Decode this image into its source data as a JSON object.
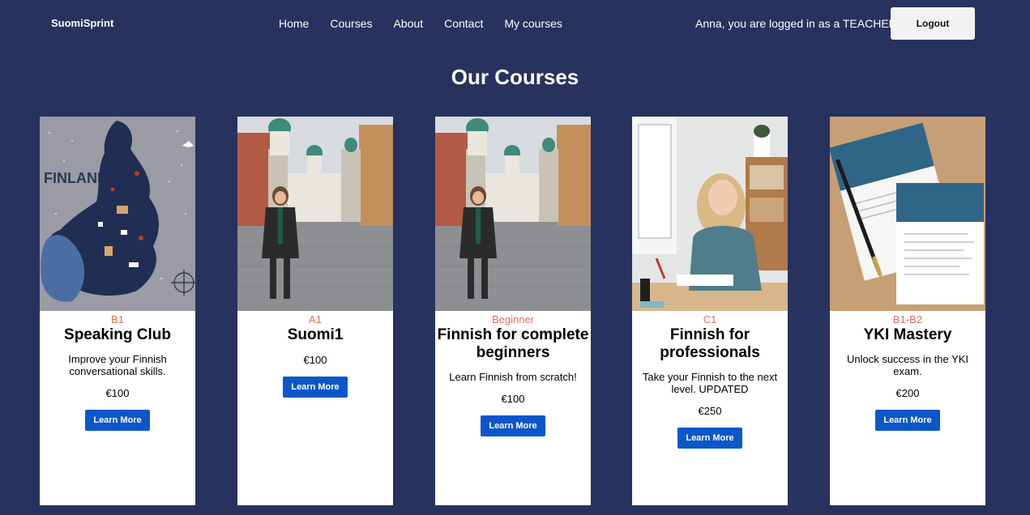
{
  "nav": {
    "brand": "SuomiSprint",
    "links": [
      "Home",
      "Courses",
      "About",
      "Contact",
      "My courses"
    ],
    "user_status": "Anna, you are logged in as a TEACHER",
    "logout_label": "Logout"
  },
  "page": {
    "title": "Our Courses"
  },
  "courses": [
    {
      "level": "B1",
      "title": "Speaking Club",
      "description": "Improve your Finnish conversational skills.",
      "price": "€100",
      "button": "Learn More",
      "image": "illustrated-finland-map"
    },
    {
      "level": "A1",
      "title": "Suomi1",
      "description": "",
      "price": "€100",
      "button": "Learn More",
      "image": "woman-in-helsinki-square"
    },
    {
      "level": "Beginner",
      "title": "Finnish for complete beginners",
      "description": "Learn Finnish from scratch!",
      "price": "€100",
      "button": "Learn More",
      "image": "woman-in-helsinki-square"
    },
    {
      "level": "C1",
      "title": "Finnish for professionals",
      "description": "Take your Finnish to the next level. UPDATED",
      "price": "€250",
      "button": "Learn More",
      "image": "woman-studying-at-desk"
    },
    {
      "level": "B1-B2",
      "title": "YKI Mastery",
      "description": "Unlock success in the YKI exam.",
      "price": "€200",
      "button": "Learn More",
      "image": "yki-documents-with-pen"
    }
  ],
  "colors": {
    "background": "#27325e",
    "card": "#ffffff",
    "level": "#e06b5a",
    "button": "#0b57c9"
  }
}
